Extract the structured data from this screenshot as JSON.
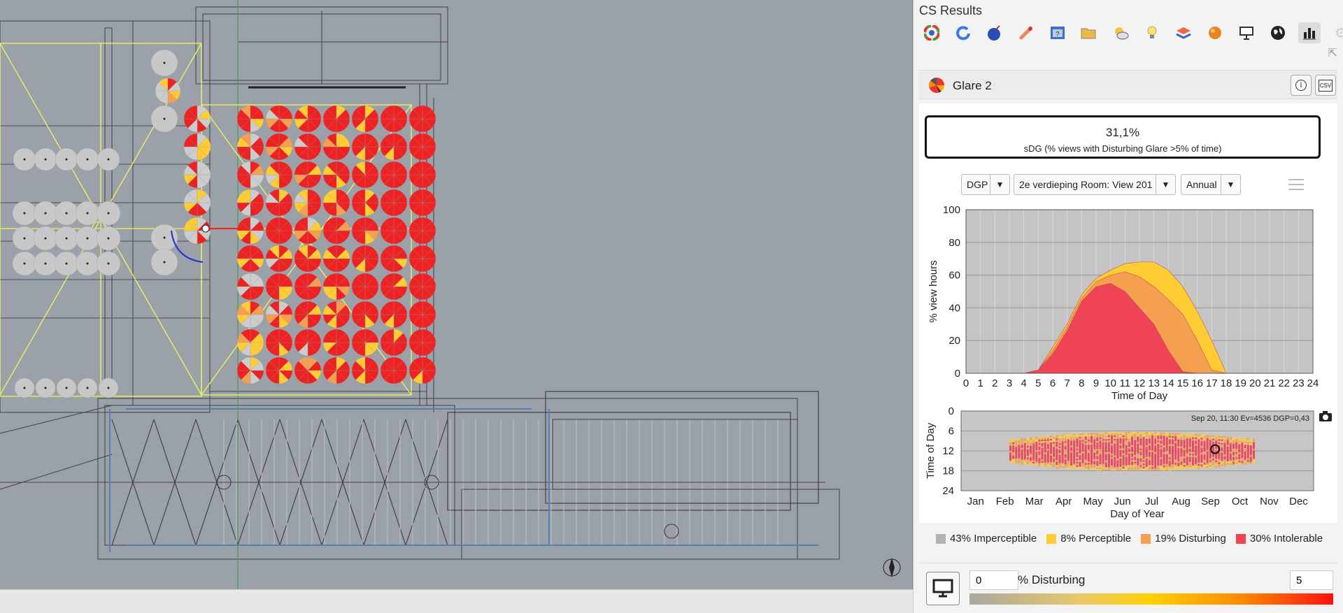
{
  "panel": {
    "title": "CS Results",
    "toolbar_icons": [
      "color-wheel-icon",
      "refresh-icon",
      "bomb-icon",
      "pipette-icon",
      "help-window-icon",
      "folder-open-icon",
      "sun-cloud-icon",
      "lightbulb-icon",
      "layers-icon",
      "sphere-icon",
      "monitor-stand-icon",
      "globe-icon",
      "bar-chart-icon",
      "gear-icon"
    ],
    "section_title": "Glare 2",
    "info_label": "i",
    "csv_label": "CSV"
  },
  "metric": {
    "value": "31,1%",
    "description": "sDG (% views with Disturbing Glare >5% of time)"
  },
  "controls": {
    "metric_select": "DGP",
    "view_select": "2e verdieping Room: View 201",
    "period_select": "Annual"
  },
  "chart_data": [
    {
      "type": "area",
      "ylabel": "% view hours",
      "xlabel": "Time of Day",
      "x": [
        0,
        1,
        2,
        3,
        4,
        5,
        6,
        7,
        8,
        9,
        10,
        11,
        12,
        13,
        14,
        15,
        16,
        17,
        18,
        19,
        20,
        21,
        22,
        23,
        24
      ],
      "xlim": [
        0,
        24
      ],
      "ylim": [
        0,
        100
      ],
      "yticks": [
        0,
        20,
        40,
        60,
        80,
        100
      ],
      "grid": true,
      "series": [
        {
          "name": "Perceptible",
          "color": "#ffcc33",
          "values": [
            0,
            0,
            0,
            0,
            0,
            2,
            16,
            30,
            48,
            58,
            63,
            67,
            68,
            68,
            63,
            53,
            38,
            20,
            0,
            0,
            0,
            0,
            0,
            0,
            0
          ]
        },
        {
          "name": "Disturbing",
          "color": "#f5a050",
          "values": [
            0,
            0,
            0,
            0,
            0,
            2,
            14,
            28,
            46,
            56,
            60,
            62,
            59,
            53,
            45,
            36,
            20,
            2,
            0,
            0,
            0,
            0,
            0,
            0,
            0
          ]
        },
        {
          "name": "Intolerable",
          "color": "#ee4455",
          "values": [
            0,
            0,
            0,
            0,
            0,
            2,
            12,
            26,
            44,
            53,
            55,
            50,
            40,
            30,
            14,
            1,
            0,
            0,
            0,
            0,
            0,
            0,
            0,
            0,
            0
          ]
        }
      ]
    },
    {
      "type": "heatmap",
      "ylabel": "Time of Day",
      "xlabel": "Day of Year",
      "xticks": [
        "Jan",
        "Feb",
        "Mar",
        "Apr",
        "May",
        "Jun",
        "Jul",
        "Aug",
        "Sep",
        "Oct",
        "Nov",
        "Dec"
      ],
      "yticks": [
        "0",
        "6",
        "12",
        "18",
        "24"
      ],
      "annotation": "Sep 20, 11:30 Ev=4536 DGP=0,43",
      "selected": {
        "day": 263,
        "hour": 11.5
      }
    }
  ],
  "legend": [
    {
      "label": "43% Imperceptible",
      "color": "#b3b3b3"
    },
    {
      "label": "8% Perceptible",
      "color": "#ffcc33"
    },
    {
      "label": "19% Disturbing",
      "color": "#f5a050"
    },
    {
      "label": "30% Intolerable",
      "color": "#ee4455"
    }
  ],
  "bottom": {
    "min_value": "0",
    "label": "% Disturbing",
    "max_value": "5"
  }
}
